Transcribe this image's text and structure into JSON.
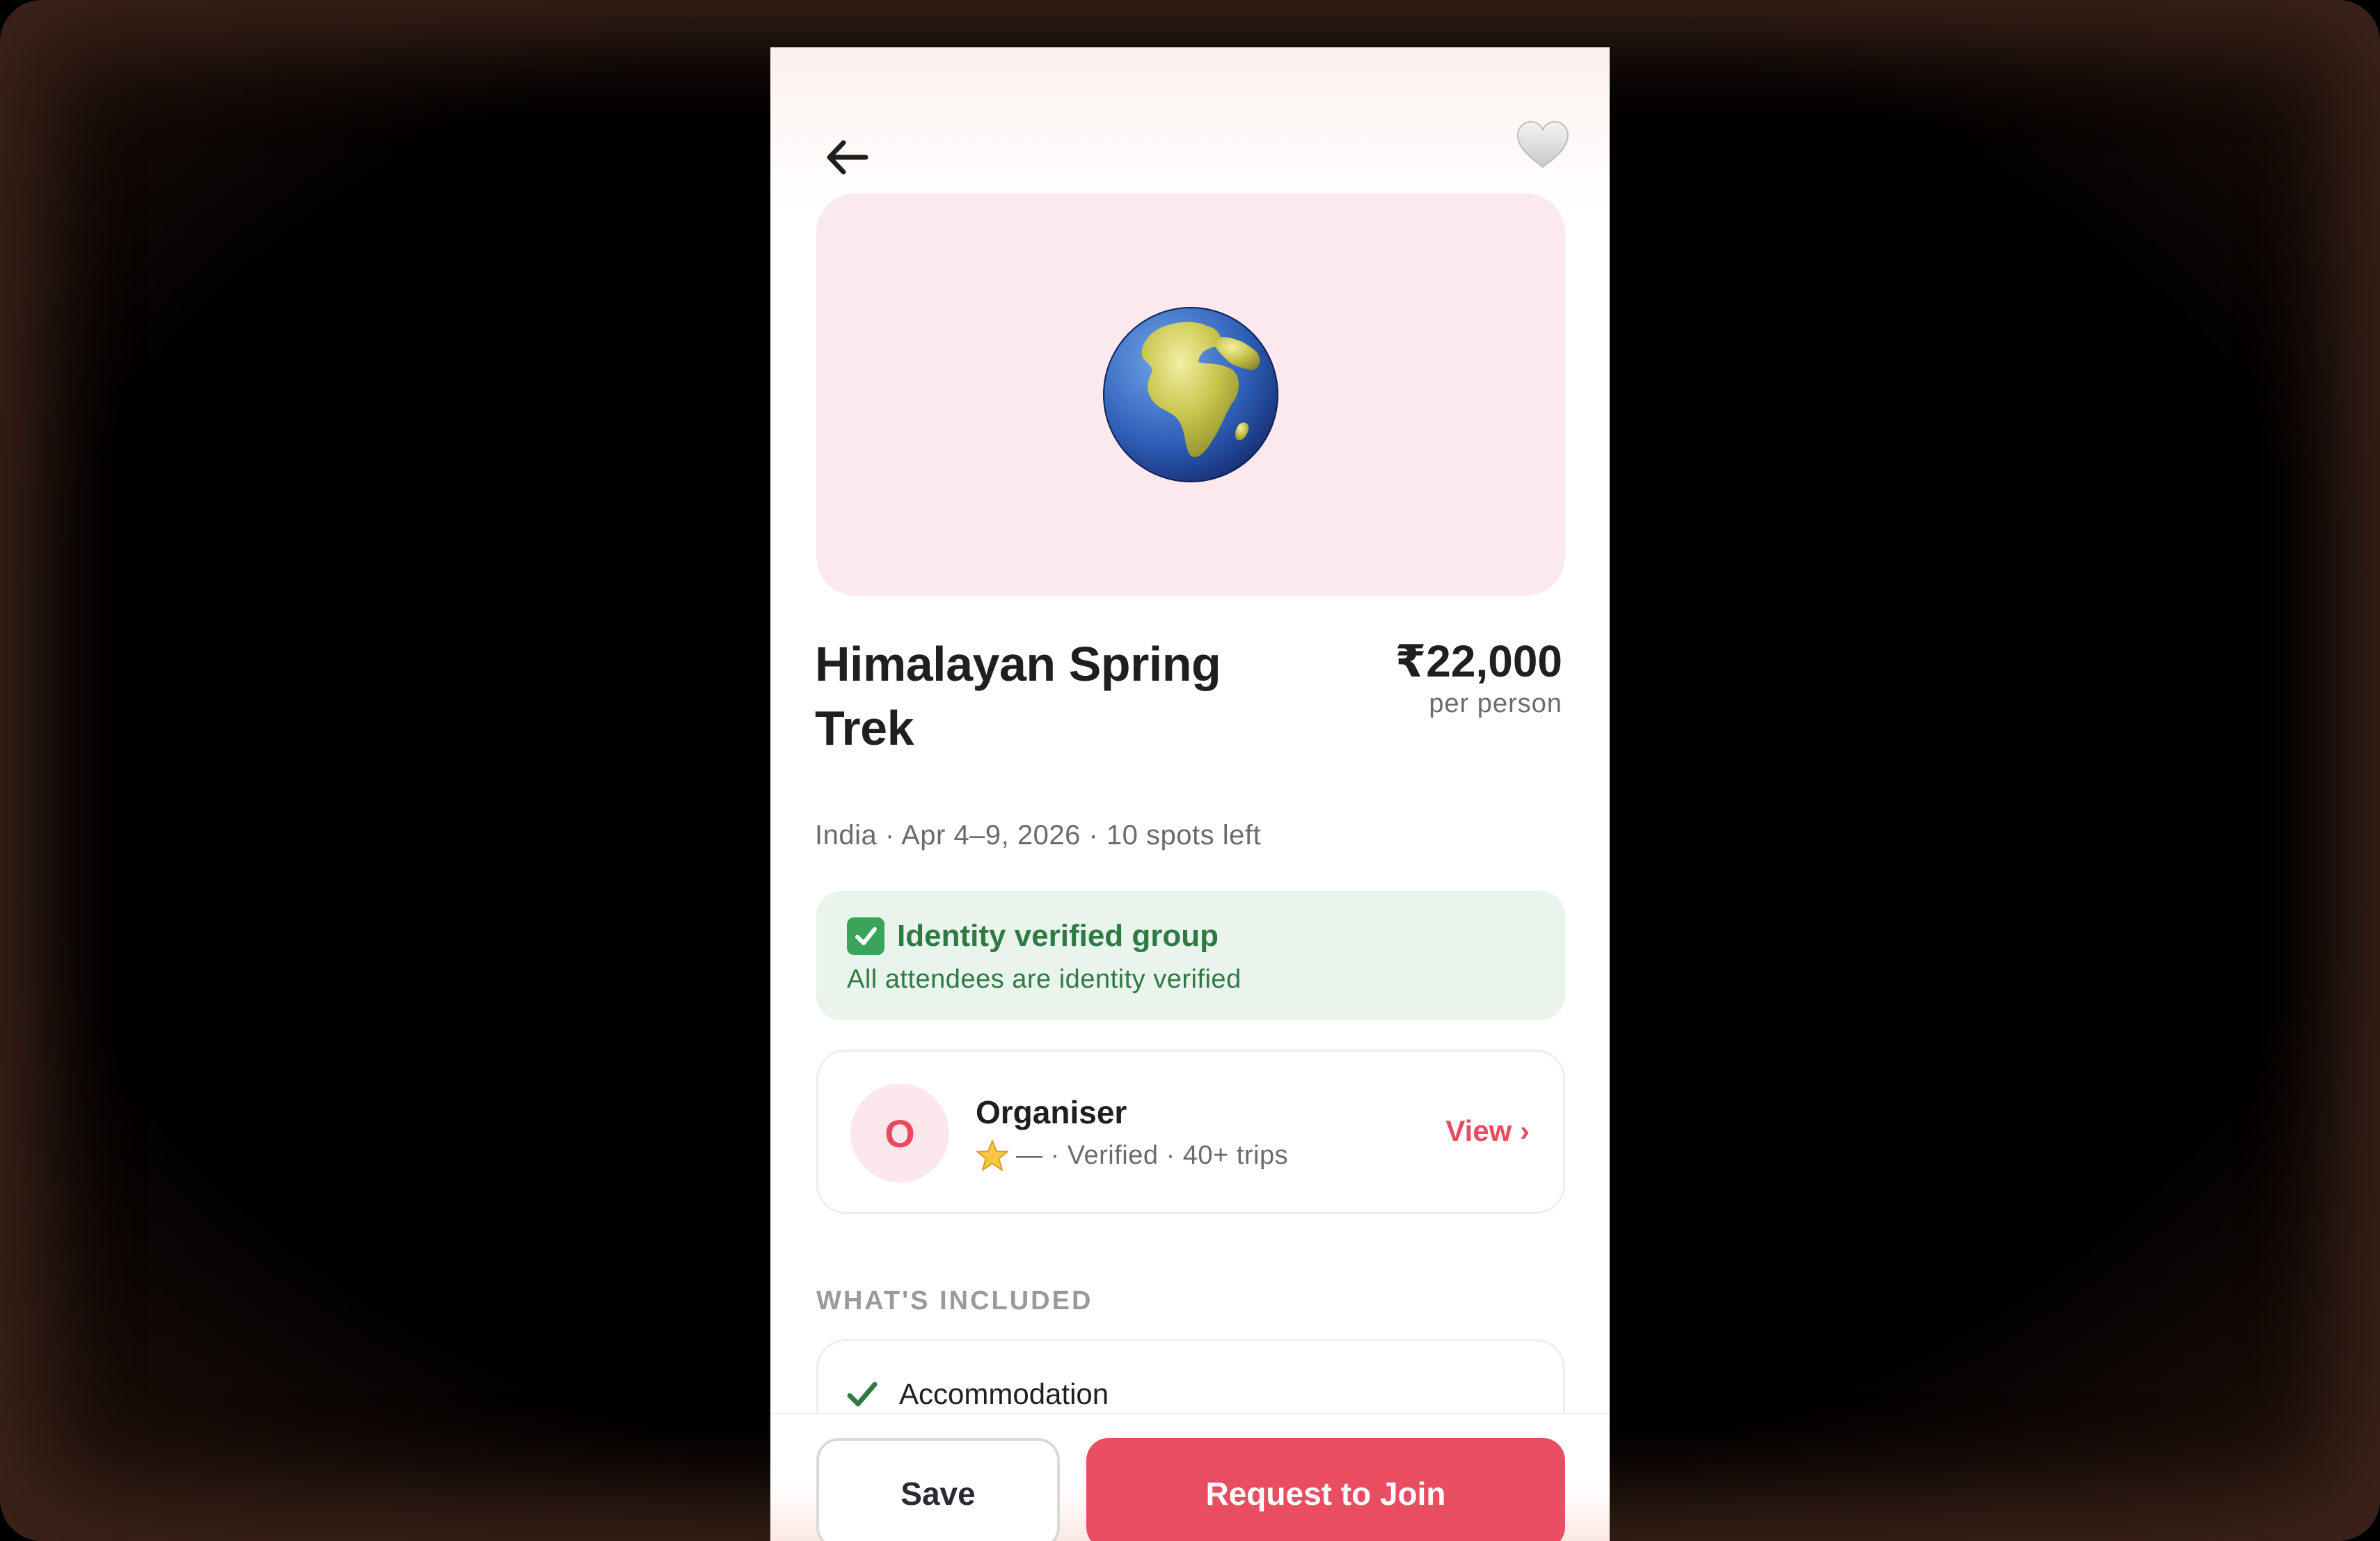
{
  "header": {
    "back_icon": "arrow-left-icon",
    "favorite_icon": "heart-outline-icon"
  },
  "hero": {
    "icon": "globe-europe-africa-icon",
    "background_color": "#fbe9ee"
  },
  "trip": {
    "title": "Himalayan Spring Trek",
    "price": "₹22,000",
    "price_unit": "per person",
    "meta": "India · Apr 4–9, 2026 · 10 spots left"
  },
  "verification": {
    "icon": "check-box-icon",
    "title": "Identity verified group",
    "subtitle": "All attendees are identity verified",
    "background_color": "#e8f4ec",
    "text_color": "#2f7a43"
  },
  "organiser": {
    "avatar_initial": "O",
    "name": "Organiser",
    "rating_icon": "star-icon",
    "meta": "— · Verified · 40+ trips",
    "view_label": "View ›"
  },
  "included": {
    "section_label": "WHAT'S INCLUDED",
    "items": [
      {
        "icon": "checkmark-icon",
        "label": "Accommodation"
      }
    ]
  },
  "actions": {
    "save_label": "Save",
    "join_label": "Request to Join",
    "accent_color": "#e84d62"
  }
}
